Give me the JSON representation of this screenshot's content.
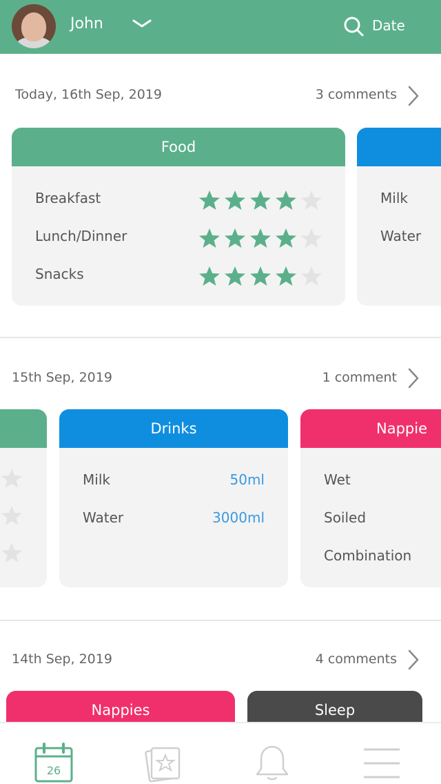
{
  "header": {
    "user_name": "John",
    "date_label": "Date"
  },
  "sections": [
    {
      "date": "Today, 16th Sep, 2019",
      "comments": "3 comments",
      "food": {
        "title": "Food",
        "rows": [
          {
            "label": "Breakfast",
            "rating": 4,
            "max": 5
          },
          {
            "label": "Lunch/Dinner",
            "rating": 4,
            "max": 5
          },
          {
            "label": "Snacks",
            "rating": 4,
            "max": 5
          }
        ]
      },
      "drinks_partial": {
        "rows": [
          "Milk",
          "Water"
        ]
      }
    },
    {
      "date": "15th Sep, 2019",
      "comments": "1 comment",
      "drinks": {
        "title": "Drinks",
        "rows": [
          {
            "label": "Milk",
            "value": "50ml"
          },
          {
            "label": "Water",
            "value": "3000ml"
          }
        ]
      },
      "nappies": {
        "title": "Nappie",
        "rows": [
          "Wet",
          "Soiled",
          "Combination"
        ]
      }
    },
    {
      "date": "14th Sep, 2019",
      "comments": "4 comments",
      "cards": [
        "Nappies",
        "Sleep"
      ]
    }
  ],
  "tabbar": {
    "calendar_day": "26",
    "items": [
      "calendar-icon",
      "journal-star-icon",
      "bell-icon",
      "menu-icon"
    ]
  },
  "colors": {
    "green": "#5bb08b",
    "blue": "#0f8ee0",
    "pink": "#f0306c",
    "dark": "#4a4a4a",
    "star_on": "#5bb08b",
    "star_off": "#e3e3e3"
  }
}
